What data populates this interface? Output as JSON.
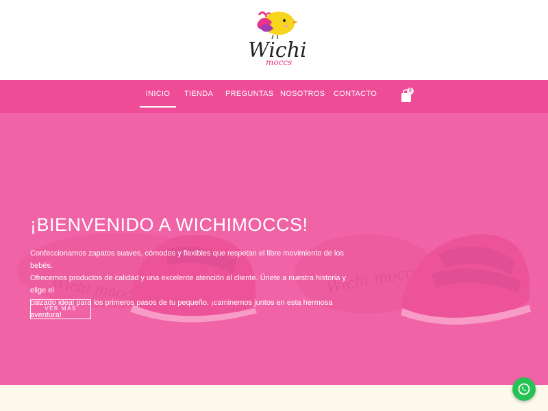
{
  "brand": {
    "logo_text": "Wichi",
    "logo_subtext": "moccs"
  },
  "nav": {
    "items": [
      {
        "label": "INICIO",
        "active": true
      },
      {
        "label": "TIENDA",
        "active": false
      },
      {
        "label": "PREGUNTAS",
        "active": false
      },
      {
        "label": "NOSOTROS",
        "active": false
      },
      {
        "label": "CONTACTO",
        "active": false
      }
    ],
    "cart_count": "0"
  },
  "hero": {
    "title": "¡BIENVENIDO A WICHIMOCCS!",
    "text_lines": [
      "Confeccionamos zapatos suaves, cómodos y flexibles que respetan el libre movimiento de los bebés.",
      "Ofrecemos productos de calidad y una excelente atención al cliente. Únete a nuestra historia y elige el",
      "calzado ideal para los primeros pasos de tu pequeño. ¡caminemos juntos en esta hermosa aventura!"
    ],
    "button_label": "VER MÁS",
    "shoe_brand_text": "Wichi moccs"
  },
  "colors": {
    "brand_pink": "#ee4c97",
    "hero_pink": "#f065a7",
    "bottom_cream": "#fdf9ec",
    "whatsapp_green": "#26c254"
  },
  "icons": {
    "cart": "shopping-bag-icon",
    "whatsapp": "whatsapp-icon",
    "logo_bird": "bird-icon"
  }
}
